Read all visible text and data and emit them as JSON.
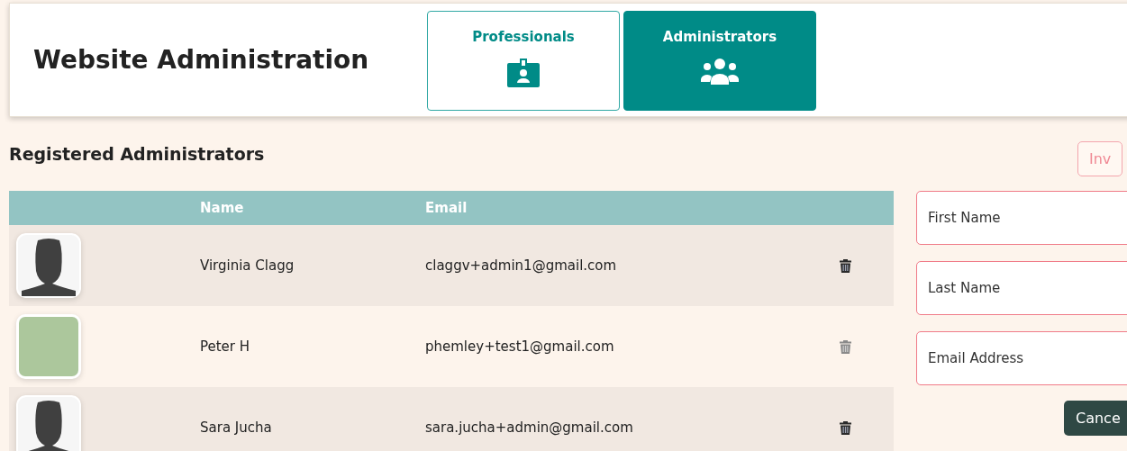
{
  "header": {
    "title": "Website Administration"
  },
  "tabs": [
    {
      "label": "Professionals",
      "kind": "badge",
      "selected": false
    },
    {
      "label": "Administrators",
      "kind": "group",
      "selected": true
    }
  ],
  "section": {
    "title": "Registered Administrators",
    "invite_button": "Inv"
  },
  "table": {
    "columns": [
      "Name",
      "Email"
    ],
    "rows": [
      {
        "kind": "silhouette",
        "name": "Virginia Clagg",
        "email": "claggv+admin1@gmail.com",
        "delete_disabled": false
      },
      {
        "kind": "placeholder",
        "name": "Peter H",
        "email": "phemley+test1@gmail.com",
        "delete_disabled": true
      },
      {
        "kind": "silhouette",
        "name": "Sara Jucha",
        "email": "sara.jucha+admin@gmail.com",
        "delete_disabled": false
      }
    ]
  },
  "form": {
    "fields": [
      {
        "placeholder": "First Name"
      },
      {
        "placeholder": "Last Name"
      },
      {
        "placeholder": "Email Address"
      }
    ],
    "cancel_button": "Cance"
  }
}
